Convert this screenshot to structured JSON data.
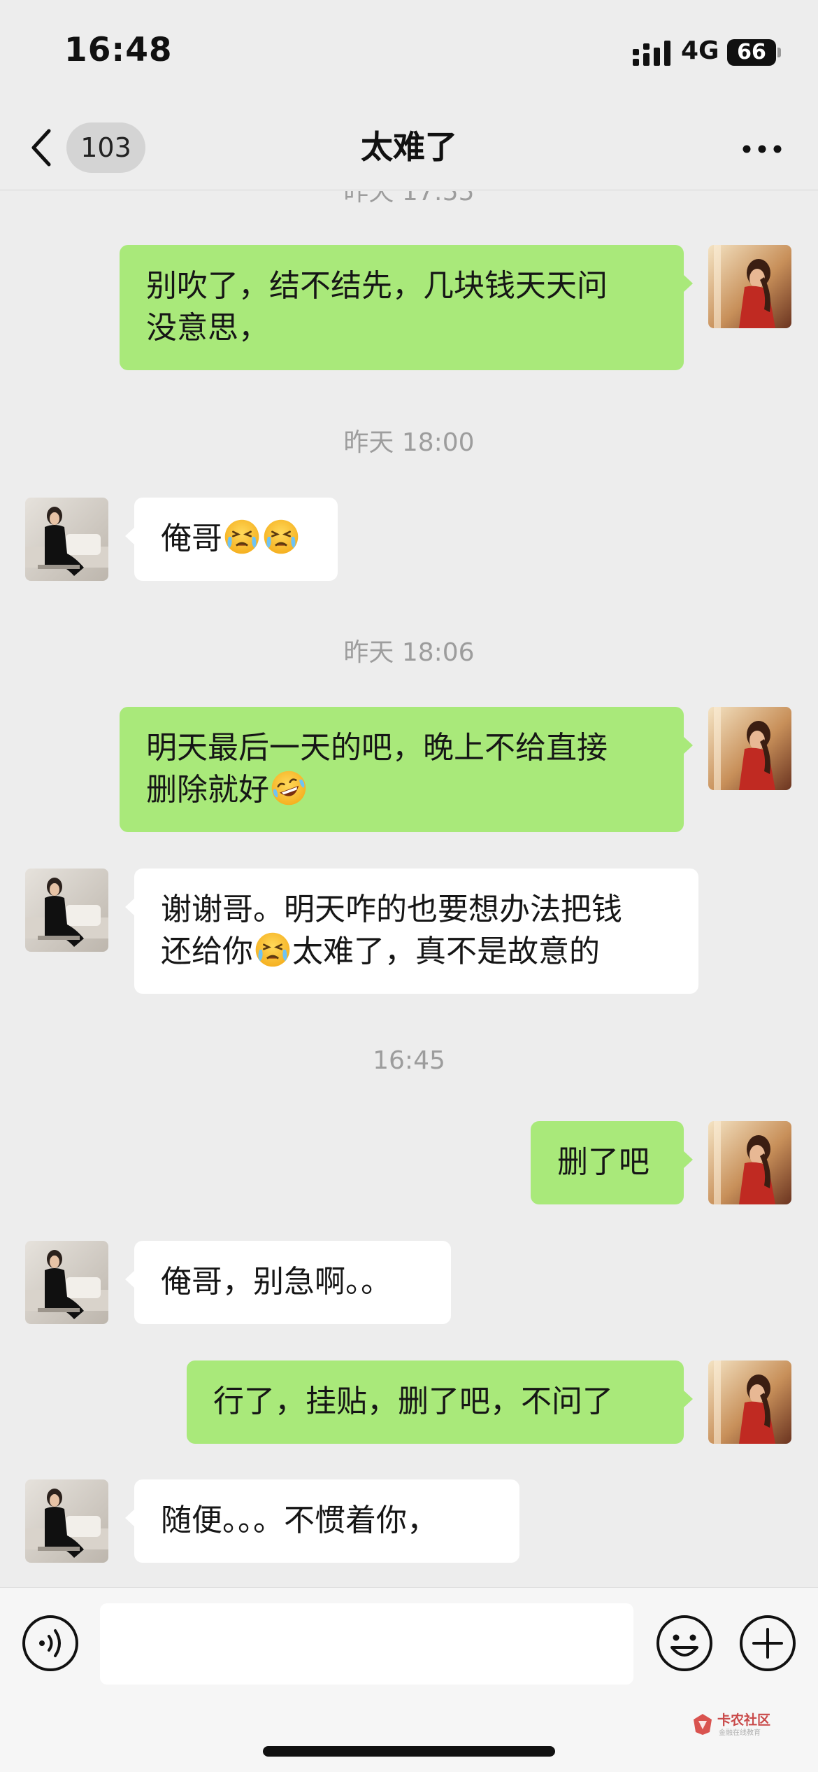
{
  "status_bar": {
    "time": "16:48",
    "network": "4G",
    "battery": "66"
  },
  "header": {
    "back_badge": "103",
    "title": "太难了"
  },
  "timestamps": {
    "t0": "昨天 17:55",
    "t1": "昨天 18:00",
    "t2": "昨天 18:06",
    "t3": "16:45"
  },
  "messages": [
    {
      "side": "out",
      "parts": [
        "别吹了，结不结先，几块钱天天问",
        "没意思，"
      ]
    },
    {
      "side": "in",
      "parts": [
        "俺哥"
      ]
    },
    {
      "side": "out",
      "parts": [
        "明天最后一天的吧，晚上不给直接",
        "删除就好"
      ]
    },
    {
      "side": "in",
      "parts": [
        "谢谢哥。明天咋的也要想办法把钱",
        "还给你",
        "太难了，真不是故意的"
      ]
    },
    {
      "side": "out",
      "parts": [
        "删了吧"
      ]
    },
    {
      "side": "in",
      "parts": [
        "俺哥，别急啊。。"
      ]
    },
    {
      "side": "out",
      "parts": [
        "行了，挂贴，删了吧，不问了"
      ]
    },
    {
      "side": "in",
      "parts": [
        "随便。。。不惯着你，"
      ]
    }
  ],
  "emojis": {
    "crying": "crying-face-emoji",
    "laughing": "rolling-laughing-emoji"
  },
  "input": {
    "value": "",
    "placeholder": ""
  },
  "watermark": {
    "title": "卡农社区",
    "subtitle": "金融在线教育"
  },
  "colors": {
    "outgoing_bubble": "#a9e97a",
    "incoming_bubble": "#ffffff",
    "background": "#ededed"
  }
}
